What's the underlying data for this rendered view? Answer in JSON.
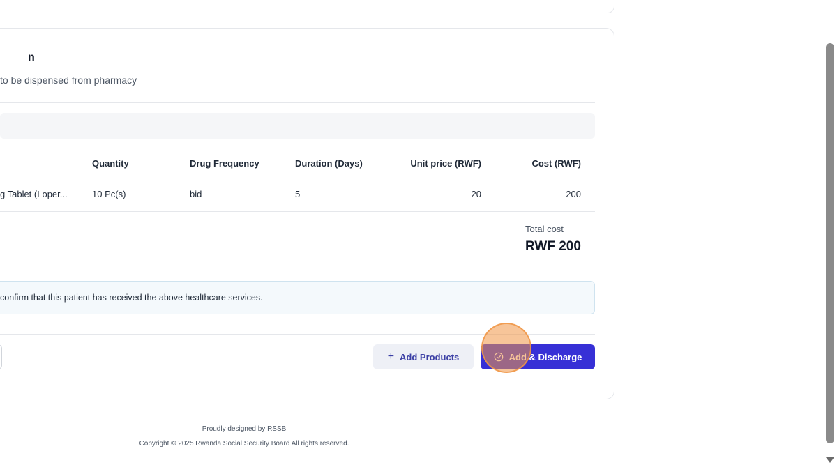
{
  "section": {
    "title": "n",
    "subtitle": "to be dispensed from pharmacy"
  },
  "table": {
    "headers": {
      "quantity": "Quantity",
      "frequency": "Drug Frequency",
      "duration": "Duration (Days)",
      "unit_price": "Unit price (RWF)",
      "cost": "Cost (RWF)"
    },
    "rows": [
      {
        "product": "g Tablet (Loper...",
        "quantity": "10 Pc(s)",
        "frequency": "bid",
        "duration": "5",
        "unit_price": "20",
        "cost": "200"
      }
    ]
  },
  "total": {
    "label": "Total cost",
    "value": "RWF 200"
  },
  "notice": {
    "text": "confirm that this patient has received the above healthcare services."
  },
  "actions": {
    "add_products": "Add Products",
    "add_discharge": "Add & Discharge"
  },
  "footer": {
    "line1": "Proudly designed by RSSB",
    "line2": "Copyright © 2025 Rwanda Social Security Board All rights reserved."
  },
  "colors": {
    "primary": "#3730d6",
    "secondary_bg": "#eef0f6",
    "notice_bg": "#f4f9fc"
  }
}
